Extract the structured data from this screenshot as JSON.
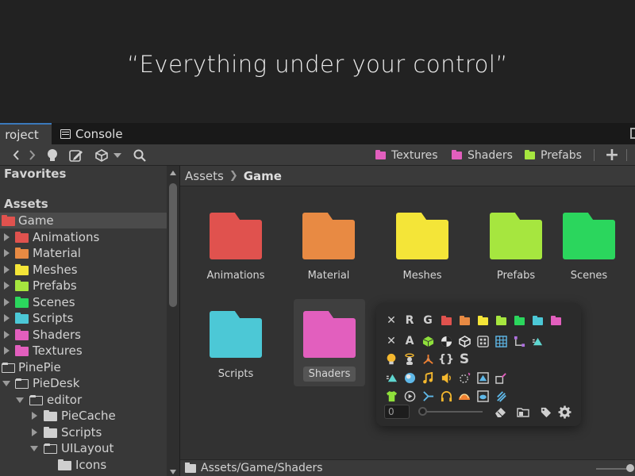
{
  "hero": {
    "tagline": "“Everything under your control”"
  },
  "tabs": [
    {
      "label": "roject"
    },
    {
      "label": "Console"
    }
  ],
  "toolbar": {
    "icons": [
      "chevron-left-icon",
      "chevron-right-icon",
      "lightbulb-icon",
      "pencil-icon",
      "unity-package-icon",
      "dropdown-caret-icon",
      "search-icon"
    ],
    "favorites": [
      {
        "label": "Textures",
        "color": "#e25fbe"
      },
      {
        "label": "Shaders",
        "color": "#e25fbe"
      },
      {
        "label": "Prefabs",
        "color": "#a6e63f"
      }
    ],
    "add_label": "+"
  },
  "tree": {
    "favorites_label": "Favorites",
    "assets_label": "Assets",
    "items": [
      {
        "label": "Game",
        "color": "#e0524e"
      },
      {
        "label": "Animations",
        "color": "#e0524e"
      },
      {
        "label": "Material",
        "color": "#e88a43"
      },
      {
        "label": "Meshes",
        "color": "#f4e538"
      },
      {
        "label": "Prefabs",
        "color": "#a6e63f"
      },
      {
        "label": "Scenes",
        "color": "#2bd65d"
      },
      {
        "label": "Scripts",
        "color": "#4cc8d6"
      },
      {
        "label": "Shaders",
        "color": "#e25fbe"
      },
      {
        "label": "Textures",
        "color": "#e25fbe"
      },
      {
        "label": "PinePie"
      },
      {
        "label": "PieDesk"
      },
      {
        "label": "editor"
      },
      {
        "label": "PieCache",
        "color": "#cfcfcf"
      },
      {
        "label": "Scripts",
        "color": "#cfcfcf"
      },
      {
        "label": "UILayout"
      },
      {
        "label": "Icons",
        "color": "#cfcfcf"
      }
    ]
  },
  "breadcrumb": {
    "root": "Assets",
    "current": "Game"
  },
  "grid": [
    {
      "label": "Animations",
      "color": "#e0524e"
    },
    {
      "label": "Material",
      "color": "#e88a43"
    },
    {
      "label": "Meshes",
      "color": "#f4e538"
    },
    {
      "label": "Prefabs",
      "color": "#a6e63f"
    },
    {
      "label": "Scenes",
      "color": "#2bd65d"
    },
    {
      "label": "Scripts",
      "color": "#4cc8d6"
    },
    {
      "label": "Shaders",
      "color": "#e25fbe"
    }
  ],
  "popup": {
    "row1_letters": [
      "✕",
      "R",
      "G"
    ],
    "row1_colors": [
      "#e0524e",
      "#e88a43",
      "#f4e538",
      "#a6e63f",
      "#2bd65d",
      "#4cc8d6",
      "#e25fbe"
    ],
    "row2_text": {
      "x": "✕",
      "a": "A",
      "braces": "{}",
      "s": "S"
    },
    "value": "0"
  },
  "pathbar": {
    "path": "Assets/Game/Shaders"
  }
}
